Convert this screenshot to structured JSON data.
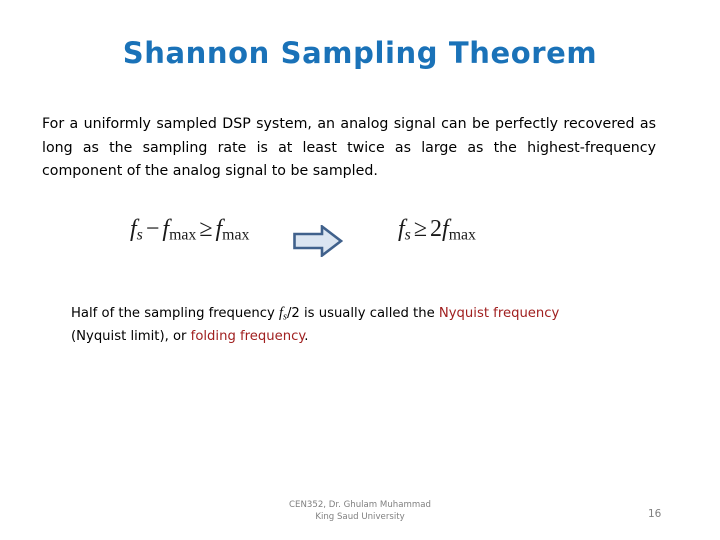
{
  "slide": {
    "title": "Shannon Sampling Theorem",
    "body_paragraph": "For a uniformly sampled DSP system, an analog signal can be perfectly recovered as long as the sampling rate is at least twice as large as the highest-frequency component of the analog signal to be sampled.",
    "equations": {
      "left": {
        "var1": "f",
        "var1_sub": "s",
        "minus": "−",
        "var2": "f",
        "var2_sub": "max",
        "relation": "≥",
        "var3": "f",
        "var3_sub": "max",
        "plain": "f_s − f_max ≥ f_max"
      },
      "arrow_icon": "right-block-arrow-icon",
      "right": {
        "var1": "f",
        "var1_sub": "s",
        "relation": "≥",
        "coefficient": "2",
        "var2": "f",
        "var2_sub": "max",
        "plain": "f_s ≥ 2f_max"
      }
    },
    "note": {
      "line1_prefix": "Half of the sampling frequency ",
      "note_var": "f",
      "note_sub": "s",
      "line1_middle": "/2 is usually called the ",
      "term1": "Nyquist frequency",
      "line2_prefix": "(Nyquist limit), or ",
      "term2": "folding frequency",
      "line2_suffix": "."
    },
    "footer": {
      "line1": "CEN352, Dr. Ghulam Muhammad",
      "line2": "King Saud University"
    },
    "page_number": "16"
  },
  "colors": {
    "title_blue": "#1a72b8",
    "accent_red": "#a01f1f",
    "arrow_fill": "#dbe5f1",
    "arrow_stroke": "#40618c",
    "footer_gray": "#808080",
    "body_text": "#000000",
    "background": "#ffffff"
  }
}
